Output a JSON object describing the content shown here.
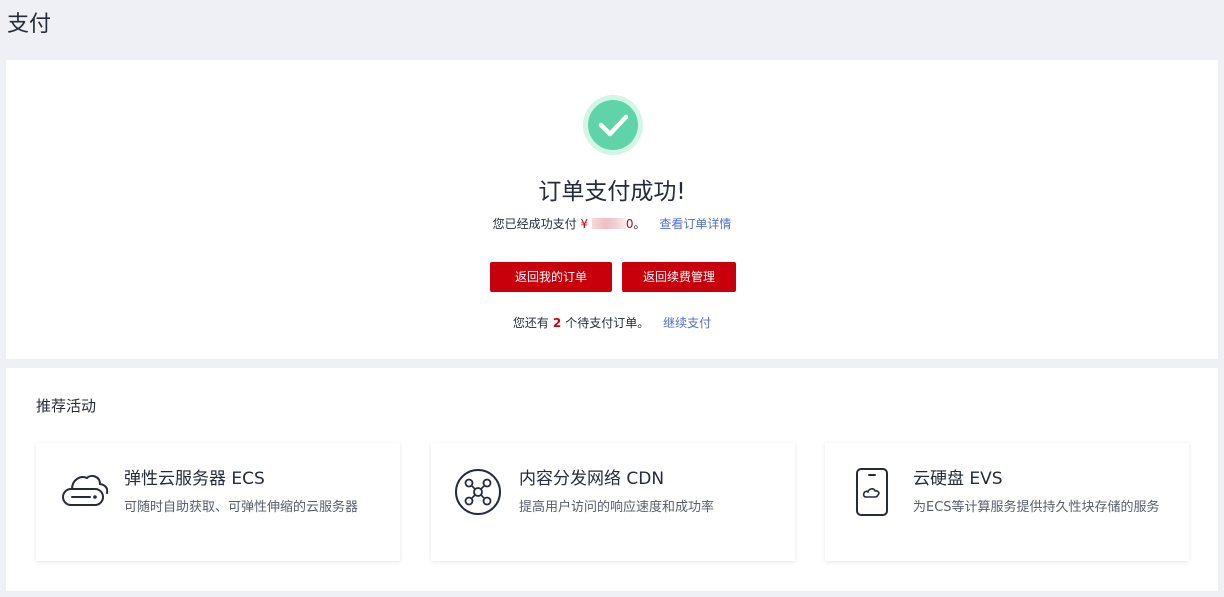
{
  "page": {
    "title": "支付"
  },
  "success": {
    "title": "订单支付成功!",
    "paid_prefix": "您已经成功支付",
    "currency": "¥",
    "amount_visible": "0",
    "amount_suffix": "。",
    "detail_link": "查看订单详情",
    "buttons": {
      "orders": "返回我的订单",
      "renewal": "返回续费管理"
    },
    "pending_prefix": "您还有",
    "pending_count": "2",
    "pending_suffix": "个待支付订单。",
    "continue_link": "继续支付",
    "colors": {
      "accent": "#c7000b",
      "link": "#526ecc",
      "success": "#5ed4a8"
    }
  },
  "recommend": {
    "title": "推荐活动",
    "items": [
      {
        "icon": "cloud-server-icon",
        "name": "弹性云服务器 ECS",
        "desc": "可随时自助获取、可弹性伸缩的云服务器"
      },
      {
        "icon": "network-nodes-icon",
        "name": "内容分发网络 CDN",
        "desc": "提高用户访问的响应速度和成功率"
      },
      {
        "icon": "cloud-disk-icon",
        "name": "云硬盘 EVS",
        "desc": "为ECS等计算服务提供持久性块存储的服务"
      }
    ]
  }
}
